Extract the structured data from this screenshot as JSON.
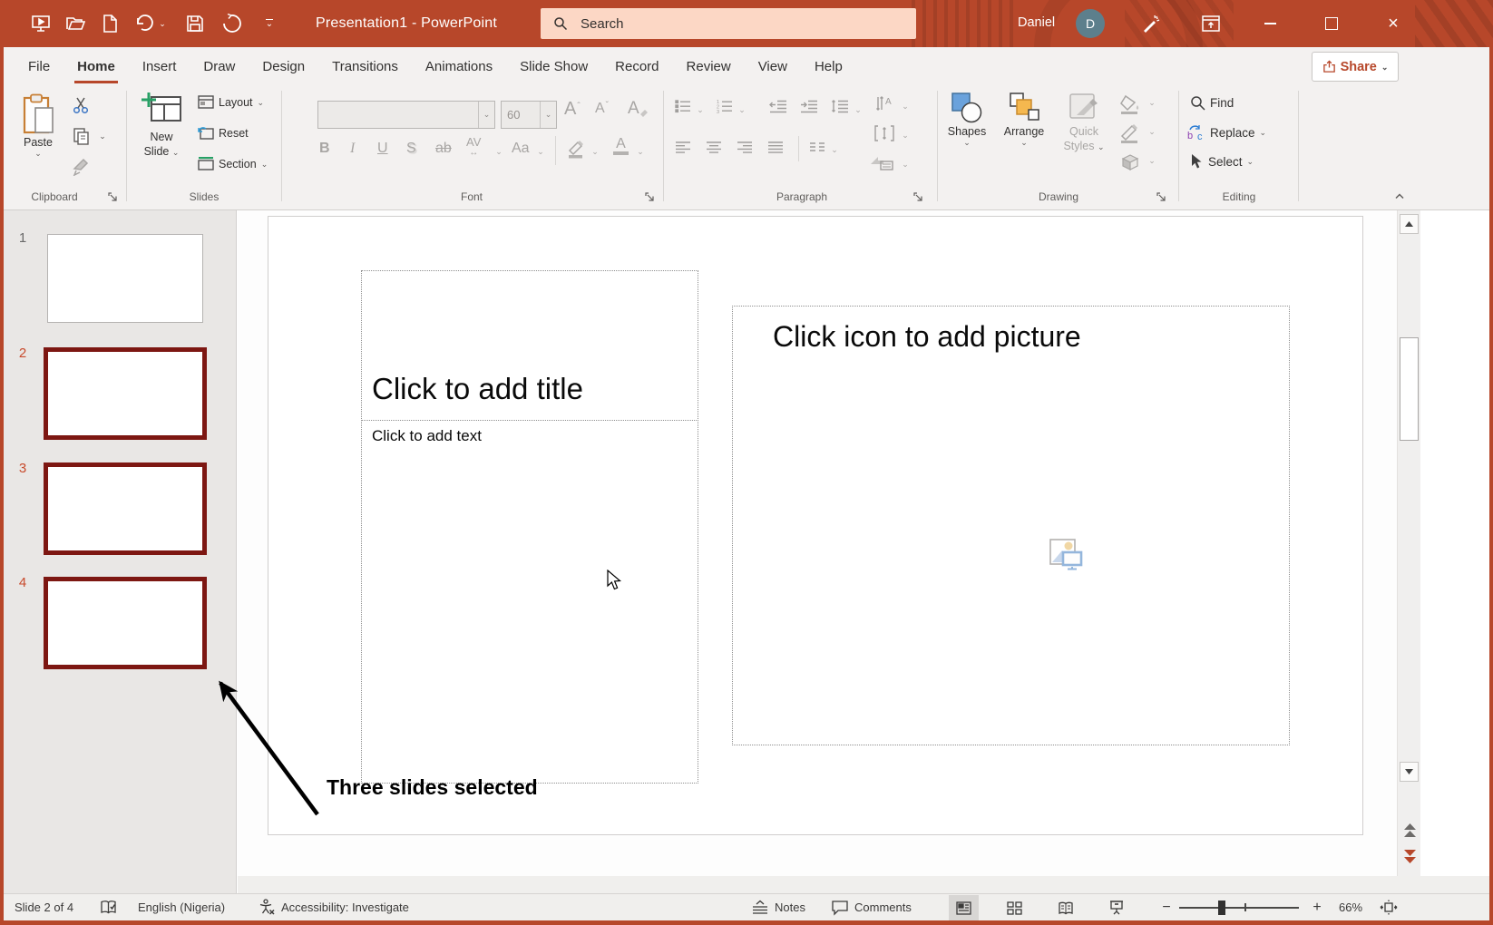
{
  "titlebar": {
    "title": "Presentation1 - PowerPoint",
    "search_placeholder": "Search",
    "user_name": "Daniel",
    "avatar_initial": "D"
  },
  "tabs": [
    {
      "label": "File"
    },
    {
      "label": "Home",
      "active": true
    },
    {
      "label": "Insert"
    },
    {
      "label": "Draw"
    },
    {
      "label": "Design"
    },
    {
      "label": "Transitions"
    },
    {
      "label": "Animations"
    },
    {
      "label": "Slide Show"
    },
    {
      "label": "Record"
    },
    {
      "label": "Review"
    },
    {
      "label": "View"
    },
    {
      "label": "Help"
    }
  ],
  "share_label": "Share",
  "ribbon": {
    "clipboard": {
      "label": "Clipboard",
      "paste": "Paste"
    },
    "slides": {
      "label": "Slides",
      "new_line1": "New",
      "new_line2": "Slide",
      "layout": "Layout",
      "reset": "Reset",
      "section": "Section"
    },
    "font": {
      "label": "Font",
      "size_value": "60",
      "bold": "B",
      "italic": "I",
      "underline": "U",
      "shadow": "S",
      "strikethrough": "ab",
      "spacing": "AV",
      "case": "Aa",
      "grow": "A",
      "shrink": "A",
      "clear": "A",
      "color": "A"
    },
    "paragraph": {
      "label": "Paragraph"
    },
    "drawing": {
      "label": "Drawing",
      "shapes": "Shapes",
      "arrange": "Arrange",
      "quick_line1": "Quick",
      "quick_line2": "Styles"
    },
    "editing": {
      "label": "Editing",
      "find": "Find",
      "replace": "Replace",
      "select": "Select"
    }
  },
  "thumbnails": [
    {
      "number": "1",
      "selected": false
    },
    {
      "number": "2",
      "selected": true
    },
    {
      "number": "3",
      "selected": true
    },
    {
      "number": "4",
      "selected": true
    }
  ],
  "slide": {
    "title_placeholder": "Click to add title",
    "body_placeholder": "Click to add text",
    "picture_placeholder": "Click icon to add picture"
  },
  "annotation": {
    "text": "Three slides selected"
  },
  "statusbar": {
    "slide_indicator": "Slide 2 of 4",
    "language": "English (Nigeria)",
    "accessibility": "Accessibility: Investigate",
    "notes": "Notes",
    "comments": "Comments",
    "zoom_level": "66%"
  },
  "colors": {
    "accent": "#b7472a",
    "selected_slide_border": "#7d1712",
    "selected_slide_number": "#c84a2c",
    "search_box_bg": "#fcd7c5",
    "avatar_bg": "#5d7f8c"
  }
}
